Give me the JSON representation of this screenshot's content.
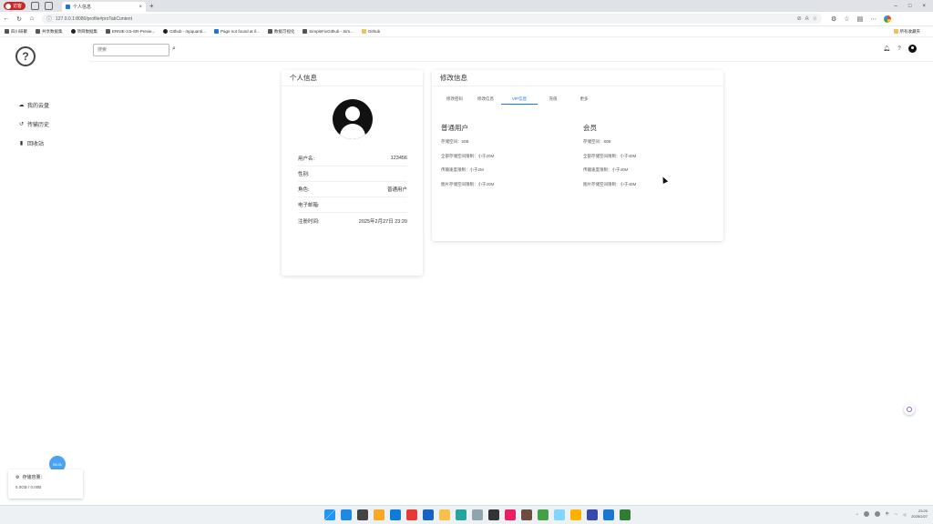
{
  "browser": {
    "guest_label": "访客",
    "tab_title": "个人信息",
    "url": "127.0.0.1:8080/profile#proTabContent",
    "new_tab": "+",
    "bookmarks": [
      {
        "label": "四川研聚",
        "kind": "plain"
      },
      {
        "label": "共享数据集",
        "kind": "plain"
      },
      {
        "label": "项目数据集",
        "kind": "gh"
      },
      {
        "label": "ERNIE-3.5-SR-Previe...",
        "kind": "plain"
      },
      {
        "label": "Github - mpquant/...",
        "kind": "gh"
      },
      {
        "label": "Page not found at /l...",
        "kind": "blue"
      },
      {
        "label": "数据可视化",
        "kind": "plain"
      },
      {
        "label": "SimpleFixGithub - Sim...",
        "kind": "plain"
      },
      {
        "label": "Github",
        "kind": "folder"
      }
    ],
    "bookmarks_right": "所有收藏夹"
  },
  "sidebar": {
    "items": [
      {
        "label": "我的云盘",
        "icon": "cloud-icon",
        "glyph": "☁"
      },
      {
        "label": "传输历史",
        "icon": "history-icon",
        "glyph": "↺"
      },
      {
        "label": "回收站",
        "icon": "trash-icon",
        "glyph": "▮"
      }
    ],
    "storage_label": "存储容量：",
    "storage_value": "5.0GB / 0.00B",
    "time_badge": "05:31"
  },
  "topbar": {
    "search_placeholder": "搜索"
  },
  "profile": {
    "title": "个人信息",
    "rows": [
      {
        "label": "用户名:",
        "value": "123456"
      },
      {
        "label": "性别:",
        "value": ""
      },
      {
        "label": "角色:",
        "value": "普通用户"
      },
      {
        "label": "电子邮箱:",
        "value": ""
      },
      {
        "label": "注册时间:",
        "value": "2025年2月27日 23:20"
      }
    ]
  },
  "edit": {
    "title": "修改信息",
    "tabs": [
      "修改密码",
      "修改信息",
      "VIP信息",
      "充值",
      "更多"
    ],
    "active_tab": 2,
    "normal": {
      "title": "普通用户",
      "lines": [
        "存储空间：50B",
        "全部存储空间限制：小于20M",
        "传输速度限制：小于2M",
        "图片存储空间限制：小于20M"
      ]
    },
    "member": {
      "title": "会员",
      "lines": [
        "存储空间：80B",
        "全部存储空间限制：小于40M",
        "传输速度限制：小于40M",
        "图片存储空间限制：小于40M"
      ]
    }
  },
  "taskbar": {
    "time": "23:20",
    "date": "2025/2/27",
    "apps": [
      "#1e88e5",
      "#444",
      "#f9a825",
      "#0b7dd8",
      "#e53935",
      "#1565c0",
      "#f6c04a",
      "#26a69a",
      "#90a4ae",
      "#333",
      "#e91e63",
      "#6d4c41",
      "#43a047",
      "#81d4fa",
      "#ffb300",
      "#3949ab",
      "#1976d2",
      "#2e7d32"
    ]
  }
}
